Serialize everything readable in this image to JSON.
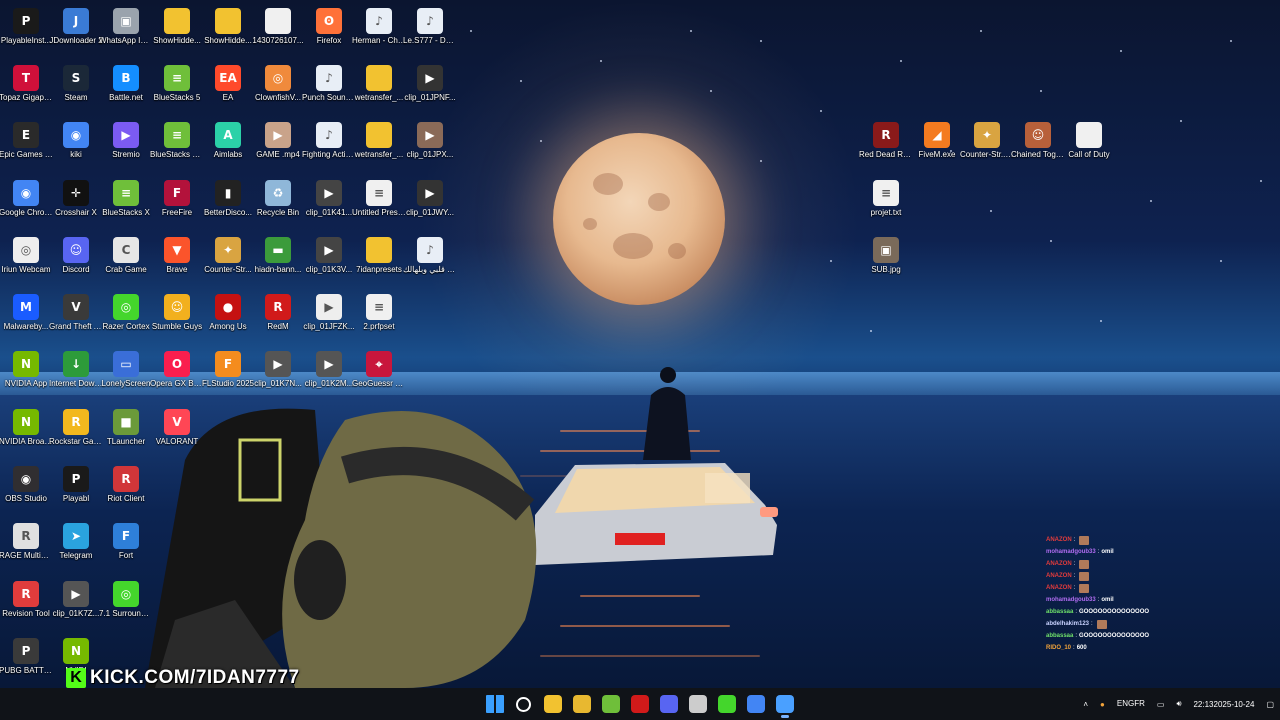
{
  "desktop_icons": [
    {
      "label": "PlayableInst...",
      "icon": "playable-icon",
      "color": "#1a1a1a",
      "glyph": "P"
    },
    {
      "label": "JDownloader 2",
      "icon": "jdownloader-icon",
      "color": "#3a7bd5",
      "glyph": "J"
    },
    {
      "label": "WhatsApp Image 2025...",
      "icon": "image-file-icon",
      "color": "#9aa3ad",
      "glyph": "▣"
    },
    {
      "label": "ShowHidde...",
      "icon": "folder-icon",
      "color": "#f2c230",
      "glyph": ""
    },
    {
      "label": "ShowHidde...",
      "icon": "folder-icon",
      "color": "#f2c230",
      "glyph": ""
    },
    {
      "label": "1430726107...",
      "icon": "file-icon",
      "color": "#f0f0f0",
      "glyph": ""
    },
    {
      "label": "Firefox",
      "icon": "firefox-icon",
      "color": "#ff7139",
      "glyph": "ʘ"
    },
    {
      "label": "Herman - Changes ...",
      "icon": "audio-file-icon",
      "color": "#e8eef6",
      "glyph": "♪"
    },
    {
      "label": "Le.S777 - Déprimé T...",
      "icon": "audio-file-icon",
      "color": "#e8eef6",
      "glyph": "♪"
    },
    {
      "label": "Topaz Gigapixel AI",
      "icon": "topaz-icon",
      "color": "#d0103a",
      "glyph": "T"
    },
    {
      "label": "Steam",
      "icon": "steam-icon",
      "color": "#1b2838",
      "glyph": "S"
    },
    {
      "label": "Battle.net",
      "icon": "battlenet-icon",
      "color": "#148eff",
      "glyph": "B"
    },
    {
      "label": "BlueStacks 5",
      "icon": "bluestacks-icon",
      "color": "#6fbf3a",
      "glyph": "≡"
    },
    {
      "label": "EA",
      "icon": "ea-icon",
      "color": "#ff4a2b",
      "glyph": "EA"
    },
    {
      "label": "ClownfishV...",
      "icon": "clownfish-icon",
      "color": "#f08a3c",
      "glyph": "◎"
    },
    {
      "label": "Punch Sound Effect..mp3",
      "icon": "audio-file-icon",
      "color": "#e8eef6",
      "glyph": "♪"
    },
    {
      "label": "wetransfer_...",
      "icon": "zip-folder-icon",
      "color": "#f2c230",
      "glyph": ""
    },
    {
      "label": "clip_01JPNF...",
      "icon": "video-file-icon",
      "color": "#333",
      "glyph": "▶"
    },
    {
      "label": "Epic Games Launcher",
      "icon": "epic-games-icon",
      "color": "#2a2a2a",
      "glyph": "E"
    },
    {
      "label": "kiki",
      "icon": "chrome-icon",
      "color": "#4285f4",
      "glyph": "◉"
    },
    {
      "label": "Stremio",
      "icon": "stremio-icon",
      "color": "#7b5bf2",
      "glyph": "▶"
    },
    {
      "label": "BlueStacks Multi-Insta...",
      "icon": "bluestacks-icon",
      "color": "#6fbf3a",
      "glyph": "≡"
    },
    {
      "label": "Aimlabs",
      "icon": "aimlabs-icon",
      "color": "#2bd1a8",
      "glyph": "A"
    },
    {
      "label": "GAME .mp4",
      "icon": "video-file-icon",
      "color": "#c9a38a",
      "glyph": "▶"
    },
    {
      "label": "Fighting Action No ...",
      "icon": "audio-file-icon",
      "color": "#e8eef6",
      "glyph": "♪"
    },
    {
      "label": "wetransfer_...",
      "icon": "zip-folder-icon",
      "color": "#f2c230",
      "glyph": ""
    },
    {
      "label": "clip_01JPX...",
      "icon": "video-file-icon",
      "color": "#8a6a58",
      "glyph": "▶"
    },
    {
      "label": "Google Chrome",
      "icon": "chrome-icon",
      "color": "#4285f4",
      "glyph": "◉"
    },
    {
      "label": "Crosshair X",
      "icon": "crosshair-icon",
      "color": "#111",
      "glyph": "✛"
    },
    {
      "label": "BlueStacks X",
      "icon": "bluestacks-icon",
      "color": "#6fbf3a",
      "glyph": "≡"
    },
    {
      "label": "FreeFire",
      "icon": "freefire-icon",
      "color": "#b3123b",
      "glyph": "F"
    },
    {
      "label": "BetterDisco...",
      "icon": "betterdiscord-icon",
      "color": "#222",
      "glyph": "▮"
    },
    {
      "label": "Recycle Bin",
      "icon": "recycle-bin-icon",
      "color": "#8fb7d9",
      "glyph": "♻"
    },
    {
      "label": "clip_01K41...",
      "icon": "video-file-icon",
      "color": "#444",
      "glyph": "▶"
    },
    {
      "label": "Untitled Preset.prfpset",
      "icon": "preset-file-icon",
      "color": "#f0f0f0",
      "glyph": "≡"
    },
    {
      "label": "clip_01JWY...",
      "icon": "video-file-icon",
      "color": "#333",
      "glyph": "▶"
    },
    {
      "label": "Iriun Webcam",
      "icon": "iriun-icon",
      "color": "#eee",
      "glyph": "◎"
    },
    {
      "label": "Discord",
      "icon": "discord-icon",
      "color": "#5865f2",
      "glyph": "☺"
    },
    {
      "label": "Crab Game",
      "icon": "crab-game-icon",
      "color": "#e6e6e6",
      "glyph": "C"
    },
    {
      "label": "Brave",
      "icon": "brave-icon",
      "color": "#fb542b",
      "glyph": "▼"
    },
    {
      "label": "Counter-Str...",
      "icon": "counter-strike-icon",
      "color": "#d9a441",
      "glyph": "✦"
    },
    {
      "label": "hiadn-bann...",
      "icon": "image-file-icon",
      "color": "#3b9b3b",
      "glyph": "▬"
    },
    {
      "label": "clip_01K3V...",
      "icon": "video-file-icon",
      "color": "#444",
      "glyph": "▶"
    },
    {
      "label": "7idanpresets",
      "icon": "folder-icon",
      "color": "#f2c230",
      "glyph": ""
    },
    {
      "label": "نصير قلبي وبلهالك.mp3",
      "icon": "audio-file-icon",
      "color": "#e8eef6",
      "glyph": "♪"
    },
    {
      "label": "Malwareby...",
      "icon": "malwarebytes-icon",
      "color": "#1a5cff",
      "glyph": "M"
    },
    {
      "label": "Grand Theft Auto V",
      "icon": "gta-icon",
      "color": "#3a3a3a",
      "glyph": "V"
    },
    {
      "label": "Razer Cortex",
      "icon": "razer-icon",
      "color": "#44d62c",
      "glyph": "◎"
    },
    {
      "label": "Stumble Guys",
      "icon": "stumble-guys-icon",
      "color": "#f2b01e",
      "glyph": "☺"
    },
    {
      "label": "Among Us",
      "icon": "among-us-icon",
      "color": "#c51111",
      "glyph": "●"
    },
    {
      "label": "RedM",
      "icon": "redm-icon",
      "color": "#d11a1a",
      "glyph": "R"
    },
    {
      "label": "clip_01JFZK...",
      "icon": "video-file-icon",
      "color": "#eee",
      "glyph": "▶"
    },
    {
      "label": "2.prfpset",
      "icon": "preset-file-icon",
      "color": "#f0f0f0",
      "glyph": "≡"
    },
    {
      "label": "NVIDIA App",
      "icon": "nvidia-icon",
      "color": "#76b900",
      "glyph": "N"
    },
    {
      "label": "Internet Downlo...",
      "icon": "idm-icon",
      "color": "#2d9b3a",
      "glyph": "↓"
    },
    {
      "label": "LonelyScreen",
      "icon": "lonelyscreen-icon",
      "color": "#3a6ed8",
      "glyph": "▭"
    },
    {
      "label": "Opera GX Browser",
      "icon": "opera-gx-icon",
      "color": "#fa1e4e",
      "glyph": "O"
    },
    {
      "label": "FLStudio 2025",
      "icon": "flstudio-icon",
      "color": "#f48c1e",
      "glyph": "F"
    },
    {
      "label": "clip_01K7N...",
      "icon": "video-file-icon",
      "color": "#555",
      "glyph": "▶"
    },
    {
      "label": "clip_01K2M...",
      "icon": "video-file-icon",
      "color": "#555",
      "glyph": "▶"
    },
    {
      "label": "GeoGuessr Steam E...",
      "icon": "geoguessr-icon",
      "color": "#c8163c",
      "glyph": "⌖"
    },
    {
      "label": "NVIDIA Broadcast",
      "icon": "nvidia-broadcast-icon",
      "color": "#76b900",
      "glyph": "N"
    },
    {
      "label": "Rockstar Games ...",
      "icon": "rockstar-icon",
      "color": "#f2b81e",
      "glyph": "R"
    },
    {
      "label": "TLauncher",
      "icon": "tlauncher-icon",
      "color": "#6b9a3a",
      "glyph": "■"
    },
    {
      "label": "VALORANT",
      "icon": "valorant-icon",
      "color": "#ff4655",
      "glyph": "V"
    },
    {
      "label": "OBS Studio",
      "icon": "obs-icon",
      "color": "#302e31",
      "glyph": "◉"
    },
    {
      "label": "Playabl",
      "icon": "playable-icon",
      "color": "#1a1a1a",
      "glyph": "P"
    },
    {
      "label": "Riot Client",
      "icon": "riot-icon",
      "color": "#d13639",
      "glyph": "R"
    },
    {
      "label": "RAGE Multiplayer",
      "icon": "rage-mp-icon",
      "color": "#e0e0e0",
      "glyph": "R"
    },
    {
      "label": "Telegram",
      "icon": "telegram-icon",
      "color": "#2aa3df",
      "glyph": "➤"
    },
    {
      "label": "Fort",
      "icon": "fortnite-icon",
      "color": "#2e7fd9",
      "glyph": "F"
    },
    {
      "label": "Revision Tool",
      "icon": "revision-tool-icon",
      "color": "#e03c3c",
      "glyph": "R"
    },
    {
      "label": "clip_01K7Z...",
      "icon": "video-file-icon",
      "color": "#555",
      "glyph": "▶"
    },
    {
      "label": "7.1 Surround Sound",
      "icon": "razer-surround-icon",
      "color": "#44d62c",
      "glyph": "◎"
    },
    {
      "label": "PUBG BATTLEGR...",
      "icon": "pubg-icon",
      "color": "#3a3a3a",
      "glyph": "P"
    },
    {
      "label": "NVIDI",
      "icon": "nvidia-icon",
      "color": "#76b900",
      "glyph": "N"
    },
    {
      "label": "Red Dead Redempti...",
      "icon": "red-dead-icon",
      "color": "#8a1a1a",
      "glyph": "R"
    },
    {
      "label": "FiveM.exe",
      "icon": "fivem-icon",
      "color": "#f47b20",
      "glyph": "◢"
    },
    {
      "label": "Counter-Str... 2",
      "icon": "counter-strike-icon",
      "color": "#d9a441",
      "glyph": "✦"
    },
    {
      "label": "Chained Together",
      "icon": "chained-together-icon",
      "color": "#b8603a",
      "glyph": "☺"
    },
    {
      "label": "Call of Duty",
      "icon": "file-icon",
      "color": "#f0f0f0",
      "glyph": ""
    },
    {
      "label": "projet.txt",
      "icon": "text-file-icon",
      "color": "#f0f0f0",
      "glyph": "≡"
    },
    {
      "label": "SUB.jpg",
      "icon": "image-file-icon",
      "color": "#7a6a5a",
      "glyph": "▣"
    }
  ],
  "overlay": {
    "kick_url": "KICK.COM/7IDAN7777",
    "kick_letter": "K"
  },
  "chat": [
    {
      "user": "ANAZON",
      "user_color": "#e33b3b",
      "msg": "",
      "emote": true
    },
    {
      "user": "mohamadgoub33",
      "user_color": "#b06cf0",
      "msg": "omil",
      "emote": false
    },
    {
      "user": "ANAZON",
      "user_color": "#e33b3b",
      "msg": "",
      "emote": true
    },
    {
      "user": "ANAZON",
      "user_color": "#e33b3b",
      "msg": "",
      "emote": true
    },
    {
      "user": "ANAZON",
      "user_color": "#e33b3b",
      "msg": "",
      "emote": true
    },
    {
      "user": "mohamadgoub33",
      "user_color": "#b06cf0",
      "msg": "omil",
      "emote": false
    },
    {
      "user": "abbassaa",
      "user_color": "#6fe06a",
      "msg": "GOOOOOOOOOOOOOO",
      "emote": false
    },
    {
      "user": "abdelhakim123",
      "user_color": "#c9d2ff",
      "msg": "",
      "emote": true
    },
    {
      "user": "abbassaa",
      "user_color": "#6fe06a",
      "msg": "GOOOOOOOOOOOOOO",
      "emote": false
    },
    {
      "user": "RIDO_10",
      "user_color": "#f2a33a",
      "msg": "600",
      "emote": false
    }
  ],
  "taskbar": {
    "apps": [
      {
        "name": "start-button",
        "color": "#3aa0ff"
      },
      {
        "name": "search-button",
        "color": "#ffffff"
      },
      {
        "name": "file-explorer-button",
        "color": "#f2c230"
      },
      {
        "name": "store-button",
        "color": "#e8b830"
      },
      {
        "name": "bluestacks-button",
        "color": "#6fbf3a"
      },
      {
        "name": "redm-button",
        "color": "#d11a1a"
      },
      {
        "name": "discord-button",
        "color": "#5865f2"
      },
      {
        "name": "crosshair-button",
        "color": "#cccccc"
      },
      {
        "name": "play-button",
        "color": "#44d62c"
      },
      {
        "name": "chrome-button",
        "color": "#4285f4"
      },
      {
        "name": "remote-desktop-button",
        "color": "#4aa0ff"
      }
    ],
    "lang_top": "ENG",
    "lang_bottom": "FR",
    "time": "22:13",
    "date": "2025-10-24"
  }
}
